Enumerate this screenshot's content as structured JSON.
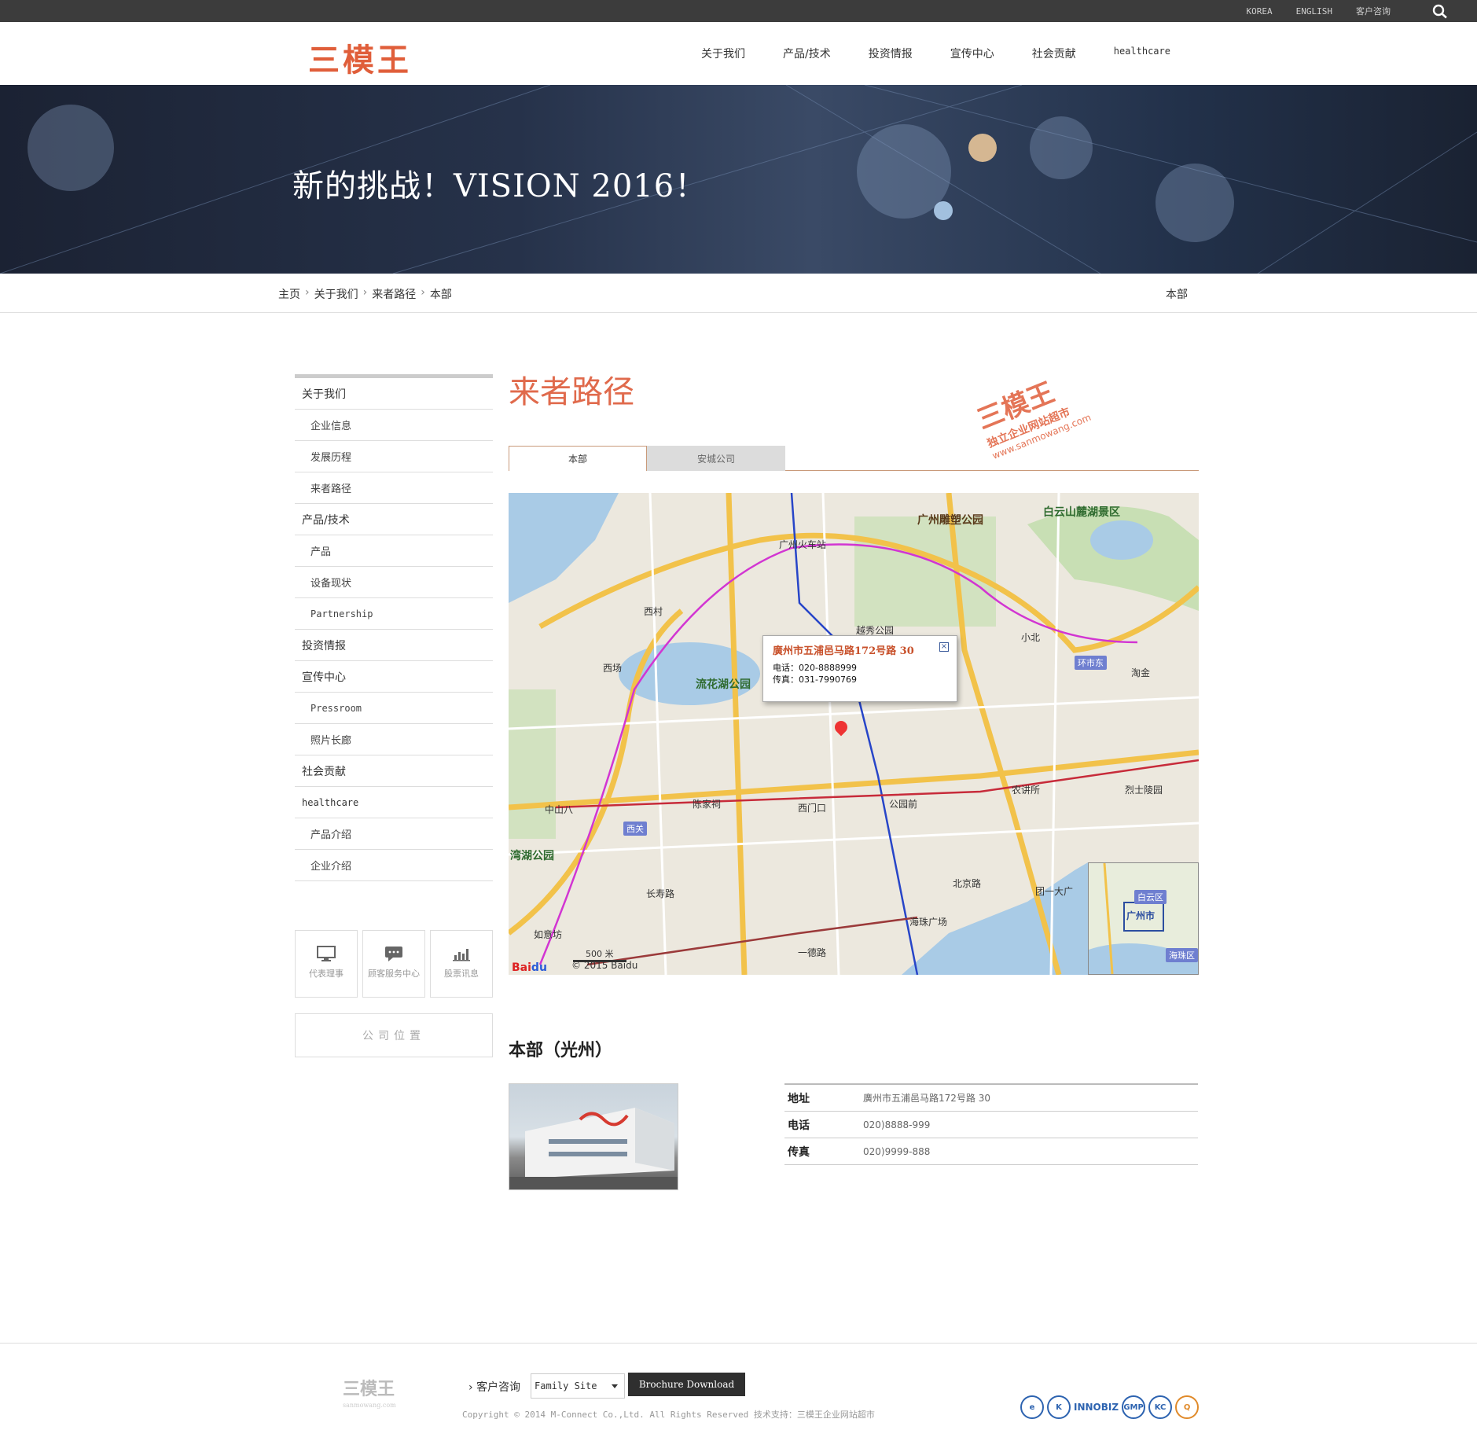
{
  "topbar": {
    "korea": "KOREA",
    "english": "ENGLISH",
    "consult": "客户咨询"
  },
  "header": {
    "logo": "三模王",
    "nav": [
      "关于我们",
      "产品/技术",
      "投资情报",
      "宣传中心",
      "社会贡献",
      "healthcare"
    ]
  },
  "banner": {
    "title": "新的挑战！VISION 2016！"
  },
  "breadcrumb": {
    "items": [
      "主页",
      "关于我们",
      "来者路径",
      "本部"
    ],
    "current": "本部"
  },
  "sidebar": {
    "items": [
      {
        "label": "关于我们",
        "level": 1
      },
      {
        "label": "企业信息",
        "level": 2
      },
      {
        "label": "发展历程",
        "level": 2
      },
      {
        "label": "来者路径",
        "level": 2
      },
      {
        "label": "产品/技术",
        "level": 1
      },
      {
        "label": "产品",
        "level": 2
      },
      {
        "label": "设备现状",
        "level": 2
      },
      {
        "label": "Partnership",
        "level": 2
      },
      {
        "label": "投资情报",
        "level": 1
      },
      {
        "label": "宣传中心",
        "level": 1
      },
      {
        "label": "Pressroom",
        "level": 2
      },
      {
        "label": "照片长廊",
        "level": 2
      },
      {
        "label": "社会贡献",
        "level": 1
      },
      {
        "label": "healthcare",
        "level": 1
      },
      {
        "label": "产品介绍",
        "level": 2
      },
      {
        "label": "企业介绍",
        "level": 2
      }
    ],
    "quick": [
      {
        "label": "代表理事",
        "icon": "monitor-icon"
      },
      {
        "label": "顾客服务中心",
        "icon": "chat-icon"
      },
      {
        "label": "股票讯息",
        "icon": "bar-chart-icon"
      }
    ],
    "location_button": "公司位置"
  },
  "main": {
    "title": "来者路径",
    "watermark": {
      "brand": "三模王",
      "line1": "独立企业网站超市",
      "url": "www.sanmowang.com"
    },
    "tabs": [
      "本部",
      "安城公司"
    ],
    "map": {
      "popup_title": "廣州市五浦邑马路172号路 30",
      "popup_phone": "电话：020-8888999",
      "popup_fax": "传真：031-7990769",
      "scale": "500 米",
      "copyright": "© 2015 Baidu",
      "labels": {
        "guangzhou_station": "广州火车站",
        "diaosu": "广州雕塑公园",
        "baiyun": "白云山麓湖景区",
        "liuhua": "流花湖公园",
        "xicun": "西村",
        "yuexiu": "越秀公园",
        "xiaobei": "小北",
        "taojin": "淘金",
        "huanshidong": "环市东",
        "ximenkou": "西门口",
        "gongyuanqian": "公园前",
        "chenjiaci": "陈家祠",
        "nongjiangsuo": "农讲所",
        "lieshilingyuan": "烈士陵园",
        "beijinglu": "北京路",
        "haizhuguangchang": "海珠广场",
        "changshoulu": "长寿路",
        "zhongshanba": "中山八",
        "ruyifang": "如意坊",
        "yide": "一德路",
        "tuanyidagang": "团一大广",
        "wanhu": "湾湖公园",
        "xichang": "西场",
        "xiguan": "西关",
        "minimap_city": "广州市",
        "minimap_baiyun": "白云区",
        "minimap_haizhu": "海珠区"
      }
    },
    "hq_title": "本部（光州）",
    "info": [
      {
        "key": "地址",
        "value": "廣州市五浦邑马路172号路 30"
      },
      {
        "key": "电话",
        "value": "020)8888-999"
      },
      {
        "key": "传真",
        "value": "020)9999-888"
      }
    ]
  },
  "footer": {
    "logo": "三模王",
    "logo_sub": "sanmowang.com",
    "consult": "客户咨询",
    "family_site": "Family Site",
    "brochure": "Brochure Download",
    "copyright": "Copyright © 2014 M-Connect Co.,Ltd. All Rights Reserved 技术支持：三模王企业网站超市",
    "badges": [
      "e",
      "K",
      "INNOBIZ",
      "GMP",
      "KC",
      "Q"
    ]
  }
}
